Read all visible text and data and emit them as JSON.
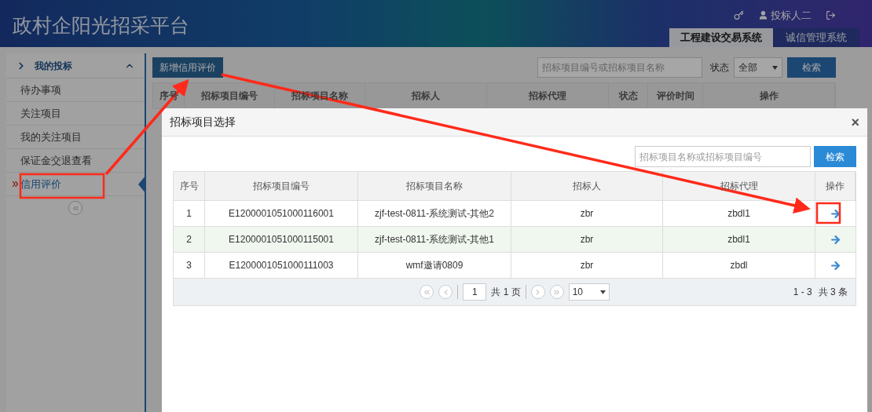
{
  "header": {
    "title": "政村企阳光招采平台",
    "user": "投标人二",
    "tabs": [
      {
        "label": "工程建设交易系统",
        "selected": true
      },
      {
        "label": "诚信管理系统",
        "selected": false
      }
    ]
  },
  "sidebar": {
    "section": "我的投标",
    "expanded": true,
    "items": [
      {
        "label": "待办事项",
        "selected": false
      },
      {
        "label": "关注项目",
        "selected": false
      },
      {
        "label": "我的关注项目",
        "selected": false
      },
      {
        "label": "保证金交退查看",
        "selected": false
      },
      {
        "label": "信用评价",
        "selected": true
      }
    ]
  },
  "toolbar": {
    "add_button": "新增信用评价",
    "search": {
      "placeholder": "招标项目编号或招标项目名称"
    },
    "status_label": "状态",
    "status_value": "全部",
    "search_button": "检索"
  },
  "table": {
    "columns": [
      "序号",
      "招标项目编号",
      "招标项目名称",
      "招标人",
      "招标代理",
      "状态",
      "评价时间",
      "操作"
    ]
  },
  "dialog": {
    "title": "招标项目选择",
    "close": "×",
    "search": {
      "placeholder": "招标项目名称或招标项目编号"
    },
    "search_button": "检索",
    "table": {
      "columns": [
        "序号",
        "招标项目编号",
        "招标项目名称",
        "招标人",
        "招标代理",
        "操作"
      ],
      "rows": [
        {
          "cells": [
            "1",
            "E1200001051000116001",
            "zjf-test-0811-系统测试-其他2",
            "zbr",
            "zbdl1"
          ]
        },
        {
          "cells": [
            "2",
            "E1200001051000115001",
            "zjf-test-0811-系统测试-其他1",
            "zbr",
            "zbdl1"
          ]
        },
        {
          "cells": [
            "3",
            "E1200001051000111003",
            "wmf邀请0809",
            "zbr",
            "zbdl"
          ]
        }
      ]
    },
    "pager": {
      "page": "1",
      "pages_text": "共 1 页",
      "page_size": "10",
      "range": "1 - 3",
      "total": "共 3 条"
    }
  }
}
